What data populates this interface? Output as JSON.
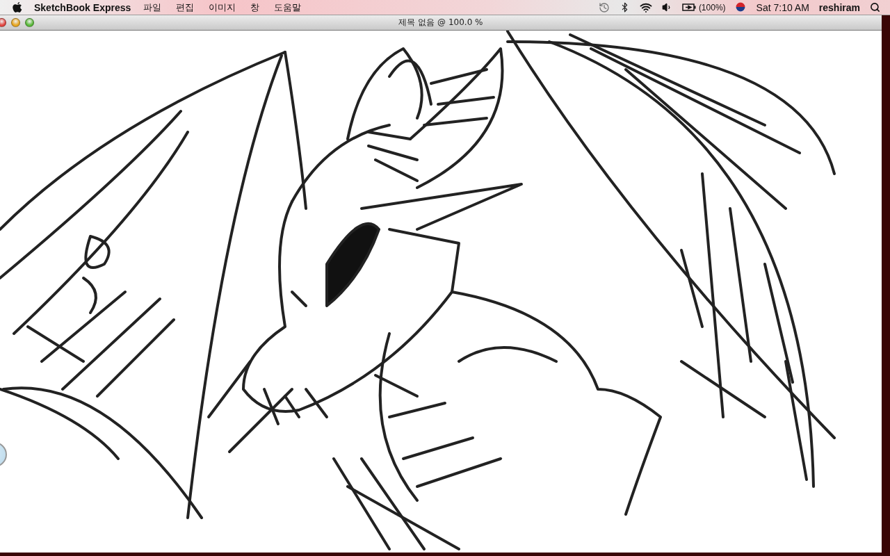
{
  "menubar": {
    "app_name": "SketchBook Express",
    "menus": [
      "파일",
      "편집",
      "이미지",
      "창",
      "도움말"
    ],
    "battery": "(100%)",
    "clock": "Sat 7:10 AM",
    "user": "reshiram"
  },
  "window": {
    "title": "제목 없음 @ 100.0 %"
  }
}
